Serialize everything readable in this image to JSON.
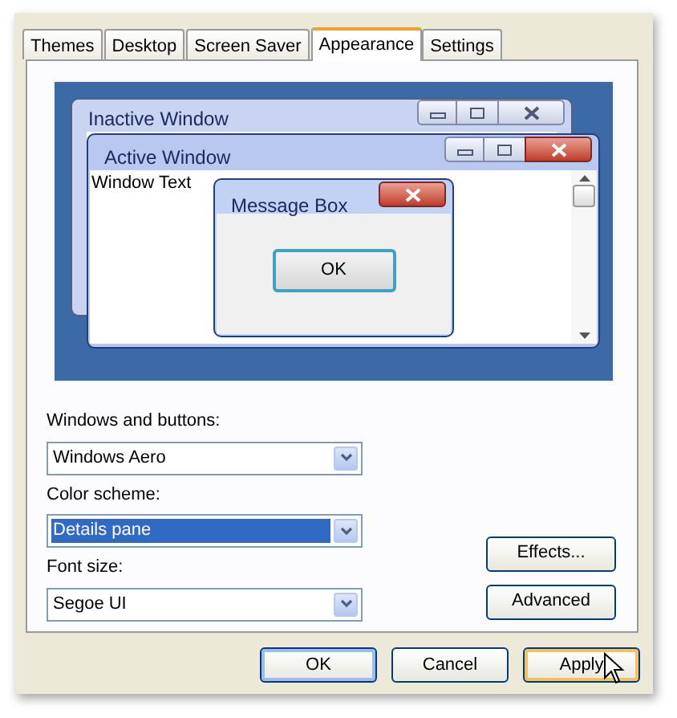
{
  "tabs": [
    {
      "label": "Themes",
      "selected": false
    },
    {
      "label": "Desktop",
      "selected": false
    },
    {
      "label": "Screen Saver",
      "selected": false
    },
    {
      "label": "Appearance",
      "selected": true
    },
    {
      "label": "Settings",
      "selected": false
    }
  ],
  "preview": {
    "inactive_title": "Inactive Window",
    "active_title": "Active Window",
    "window_text": "Window Text",
    "message_title": "Message Box",
    "message_button": "OK"
  },
  "fields": [
    {
      "label": "Windows and buttons:",
      "value": "Windows Aero",
      "selected": false
    },
    {
      "label": "Color scheme:",
      "value": "Details pane",
      "selected": true
    },
    {
      "label": "Font size:",
      "value": "Segoe UI",
      "selected": false
    }
  ],
  "side_buttons": [
    "Effects...",
    "Advanced"
  ],
  "buttons": [
    {
      "label": "OK",
      "kind": "default"
    },
    {
      "label": "Cancel",
      "kind": "normal"
    },
    {
      "label": "Apply",
      "kind": "hover"
    }
  ]
}
